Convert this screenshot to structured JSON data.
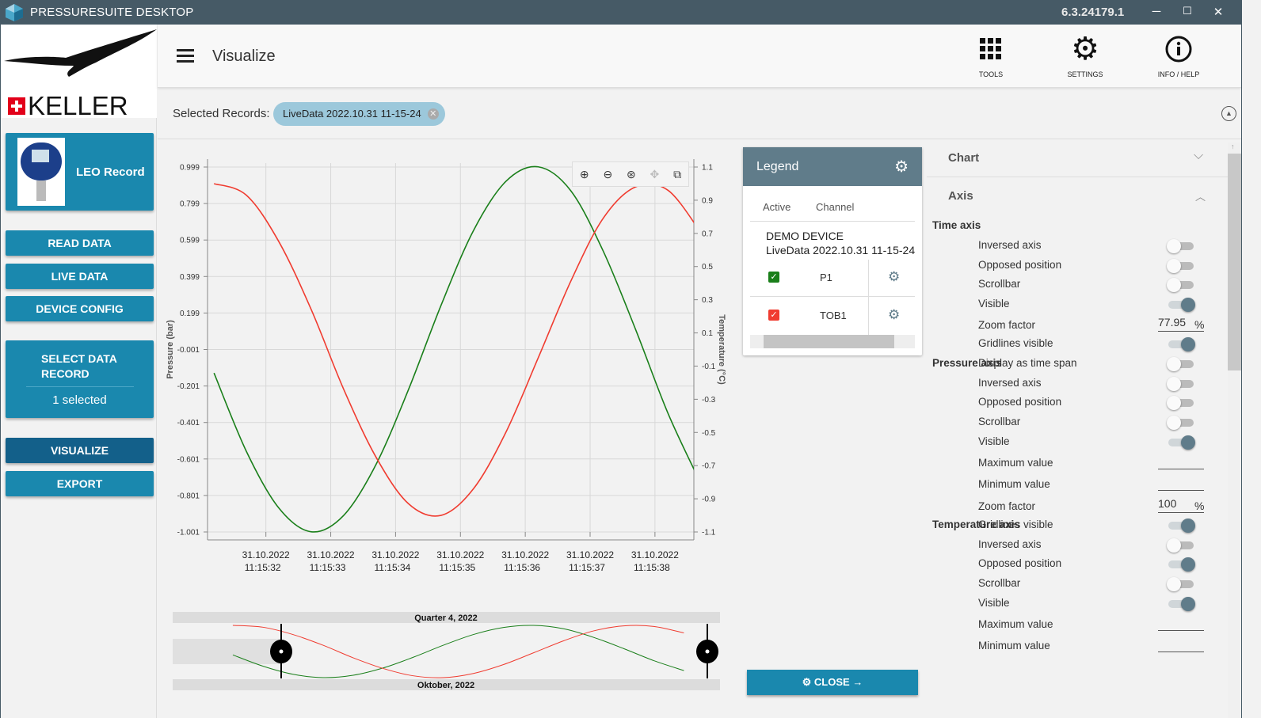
{
  "window": {
    "title": "PRESSURESUITE DESKTOP",
    "version": "6.3.24179.1",
    "minimize": "─",
    "maximize": "☐",
    "close": "✕"
  },
  "sidebar": {
    "brand": "KELLER",
    "device": {
      "label": "LEO Record"
    },
    "buttons": [
      {
        "label": "READ DATA"
      },
      {
        "label": "LIVE DATA"
      },
      {
        "label": "DEVICE CONFIG"
      }
    ],
    "select": {
      "label": "SELECT DATA RECORD",
      "count": "1 selected"
    },
    "visualize": "VISUALIZE",
    "export": "EXPORT"
  },
  "header": {
    "title": "Visualize",
    "tools": "TOOLS",
    "settings": "SETTINGS",
    "info": "INFO / HELP"
  },
  "records": {
    "label": "Selected Records:",
    "chip": "LiveData 2022.10.31 11-15-24"
  },
  "legend": {
    "title": "Legend",
    "col_active": "Active",
    "col_channel": "Channel",
    "device": "DEMO DEVICE",
    "record": "LiveData 2022.10.31 11-15-24",
    "channels": [
      {
        "name": "P1",
        "active": true,
        "color": "#1a7f1a"
      },
      {
        "name": "TOB1",
        "active": true,
        "color": "#f03c30"
      }
    ]
  },
  "close_label": "CLOSE",
  "panel": {
    "chart": "Chart",
    "axis": "Axis",
    "time_axis": {
      "title": "Time axis",
      "inversed": "Inversed axis",
      "opposed": "Opposed position",
      "scrollbar": "Scrollbar",
      "visible": "Visible",
      "zoom": "Zoom factor",
      "zoom_value": "77.95",
      "zoom_unit": "%",
      "gridlines": "Gridlines visible",
      "timespan": "Display as time span",
      "inversed_on": false,
      "opposed_on": false,
      "scrollbar_on": false,
      "visible_on": true,
      "gridlines_on": true,
      "timespan_on": false
    },
    "pressure_axis": {
      "title": "Pressure axis",
      "inversed": "Inversed axis",
      "opposed": "Opposed position",
      "scrollbar": "Scrollbar",
      "visible": "Visible",
      "max": "Maximum value",
      "min": "Minimum value",
      "zoom": "Zoom factor",
      "zoom_value": "100",
      "zoom_unit": "%",
      "gridlines": "Gridlines visible",
      "inversed_on": false,
      "opposed_on": false,
      "scrollbar_on": false,
      "visible_on": true,
      "gridlines_on": true
    },
    "temperature_axis": {
      "title": "Temperature axis",
      "inversed": "Inversed axis",
      "opposed": "Opposed position",
      "scrollbar": "Scrollbar",
      "visible": "Visible",
      "max": "Maximum value",
      "min": "Minimum value",
      "inversed_on": false,
      "opposed_on": true,
      "scrollbar_on": false,
      "visible_on": true
    }
  },
  "navigator": {
    "top_label": "Quarter 4, 2022",
    "bottom_label": "Oktober, 2022"
  },
  "chart_data": {
    "type": "line",
    "ylabel": "Pressure (bar)",
    "y2label": "Temperature (°C)",
    "x_tick_labels": [
      [
        "31.10.2022",
        "11:15:32"
      ],
      [
        "31.10.2022",
        "11:15:33"
      ],
      [
        "31.10.2022",
        "11:15:34"
      ],
      [
        "31.10.2022",
        "11:15:35"
      ],
      [
        "31.10.2022",
        "11:15:36"
      ],
      [
        "31.10.2022",
        "11:15:37"
      ],
      [
        "31.10.2022",
        "11:15:38"
      ]
    ],
    "x_ticks": [
      "11:15:32",
      "11:15:33",
      "11:15:34",
      "11:15:35",
      "11:15:36",
      "11:15:37",
      "11:15:38"
    ],
    "xlim": [
      "11:15:31.1",
      "11:15:38.6"
    ],
    "y_ticks": [
      "0.999",
      "0.799",
      "0.599",
      "0.399",
      "0.199",
      "-0.001",
      "-0.201",
      "-0.401",
      "-0.601",
      "-0.801",
      "-1.001"
    ],
    "ylim": [
      -1.001,
      0.999
    ],
    "y2_ticks": [
      "1.1",
      "0.9",
      "0.7",
      "0.5",
      "0.3",
      "0.1",
      "-0.1",
      "-0.3",
      "-0.5",
      "-0.7",
      "-0.9",
      "-1.1"
    ],
    "y2lim": [
      -1.1,
      1.1
    ],
    "grid": true,
    "x": [
      "11:15:31.2",
      "11:15:31.7",
      "11:15:32.2",
      "11:15:32.7",
      "11:15:33.2",
      "11:15:33.7",
      "11:15:34.2",
      "11:15:34.7",
      "11:15:35.2",
      "11:15:35.7",
      "11:15:36.2",
      "11:15:36.7",
      "11:15:37.2",
      "11:15:37.7",
      "11:15:38.2",
      "11:15:38.7"
    ],
    "series": [
      {
        "name": "P1",
        "axis": "left",
        "color": "#1a7f1a",
        "values": [
          -0.13,
          -0.56,
          -0.87,
          -1.0,
          -0.91,
          -0.63,
          -0.22,
          0.24,
          0.65,
          0.92,
          1.0,
          0.87,
          0.54,
          0.11,
          -0.35,
          -0.73
        ]
      },
      {
        "name": "TOB1",
        "axis": "right",
        "color": "#f03c30",
        "values": [
          1.0,
          0.93,
          0.65,
          0.24,
          -0.24,
          -0.65,
          -0.93,
          -1.0,
          -0.84,
          -0.5,
          -0.05,
          0.41,
          0.79,
          0.98,
          0.96,
          0.71
        ]
      }
    ]
  }
}
